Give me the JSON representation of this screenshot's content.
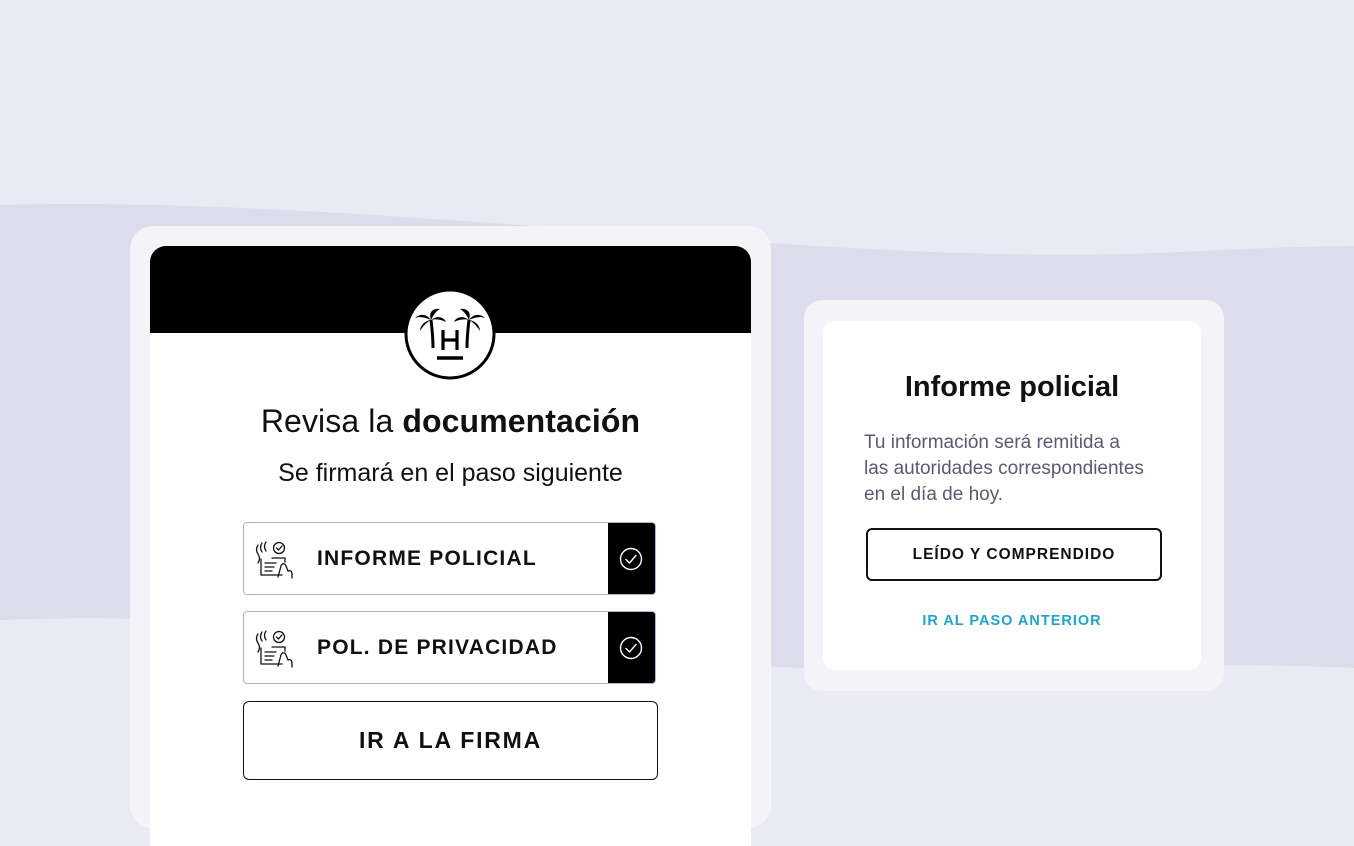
{
  "colors": {
    "background": "#e9eaf4",
    "wave": "#dcdcec",
    "header": "#000000",
    "link_accent": "#1fa4c9",
    "body_text": "#5b5a72",
    "row_border": "#a9b6cc"
  },
  "left": {
    "logo_icon": "palm-trees-h-logo-icon",
    "title_light": "Revisa la",
    "title_bold": "documentación",
    "subtitle": "Se firmará en el paso siguiente",
    "documents": [
      {
        "label": "INFORME POLICIAL",
        "icon": "document-sign-icon",
        "status": "checked"
      },
      {
        "label": "POL. DE PRIVACIDAD",
        "icon": "document-sign-icon",
        "status": "checked"
      }
    ],
    "firma_button_label": "IR A LA FIRMA"
  },
  "modal": {
    "title": "Informe policial",
    "body_lines": [
      "Tu información será remitida a",
      "las autoridades correspondientes",
      "en el día de hoy."
    ],
    "confirm_label": "LEÍDO Y COMPRENDIDO",
    "back_label": "IR AL PASO ANTERIOR"
  }
}
